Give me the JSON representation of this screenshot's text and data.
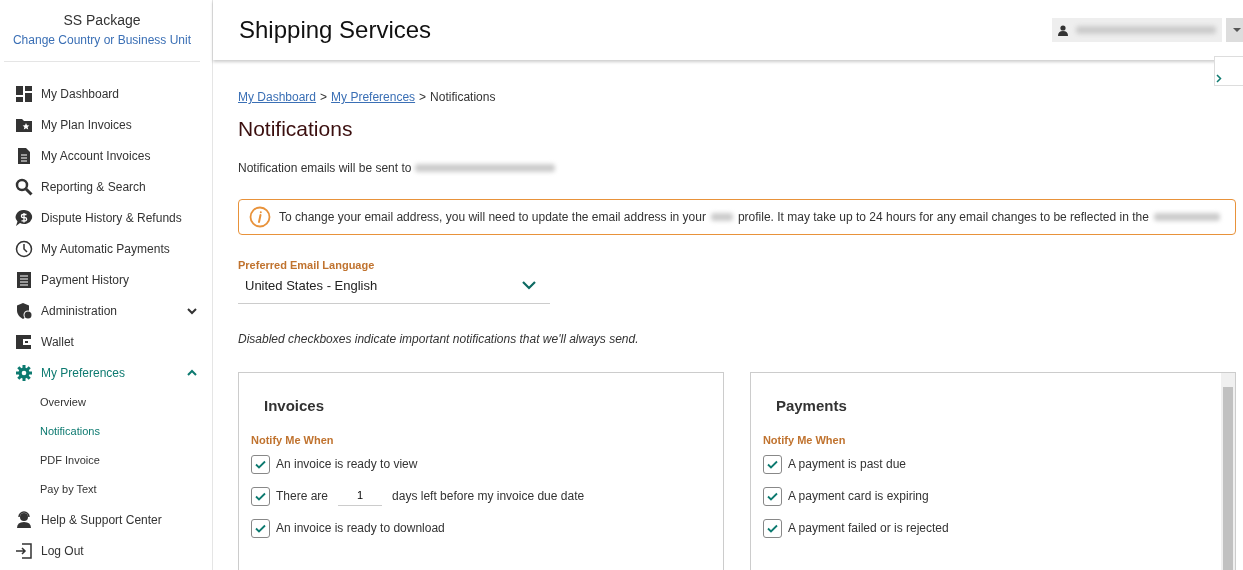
{
  "sidebar": {
    "title": "SS Package",
    "link": "Change Country or Business Unit",
    "items": [
      {
        "label": "My Dashboard",
        "selected": false
      },
      {
        "label": "My Plan Invoices",
        "selected": false
      },
      {
        "label": "My Account Invoices",
        "selected": false
      },
      {
        "label": "Reporting & Search",
        "selected": false
      },
      {
        "label": "Dispute History & Refunds",
        "selected": false
      },
      {
        "label": "My Automatic Payments",
        "selected": false
      },
      {
        "label": "Payment History",
        "selected": false
      },
      {
        "label": "Administration",
        "selected": false,
        "expanded": false
      },
      {
        "label": "Wallet",
        "selected": false
      },
      {
        "label": "My Preferences",
        "selected": true,
        "expanded": true,
        "children": [
          {
            "label": "Overview",
            "selected": false
          },
          {
            "label": "Notifications",
            "selected": true
          },
          {
            "label": "PDF Invoice",
            "selected": false
          },
          {
            "label": "Pay by Text",
            "selected": false
          }
        ]
      },
      {
        "label": "Help & Support Center",
        "selected": false
      },
      {
        "label": "Log Out",
        "selected": false
      }
    ]
  },
  "header": {
    "title": "Shipping Services"
  },
  "breadcrumb": [
    {
      "label": "My Dashboard",
      "kind": "link"
    },
    {
      "label": ">",
      "kind": "separator"
    },
    {
      "label": "My Preferences",
      "kind": "link"
    },
    {
      "label": ">",
      "kind": "separator"
    },
    {
      "label": "Notifications",
      "kind": "current"
    }
  ],
  "page_title": "Notifications",
  "email_note": "Notification emails will be sent to",
  "alert": {
    "parts": [
      "To change your email address, you will need to update the email address in your",
      "profile. It may take up to 24 hours for any email changes to be reflected in the"
    ]
  },
  "language": {
    "label": "Preferred Email Language",
    "value": "United States - English"
  },
  "disabled_note": "Disabled checkboxes indicate important notifications that we'll always send.",
  "panels": [
    {
      "title": "Invoices",
      "subtitle": "Notify Me When",
      "options": [
        {
          "kind": "plain",
          "label": "An invoice is ready to view",
          "checked": true
        },
        {
          "kind": "days",
          "before": "There are",
          "value": "1",
          "after": "days left before my invoice due date",
          "checked": true
        },
        {
          "kind": "plain",
          "label": "An invoice is ready to download",
          "checked": true
        }
      ]
    },
    {
      "title": "Payments",
      "subtitle": "Notify Me When",
      "options": [
        {
          "kind": "plain",
          "label": "A payment is past due",
          "checked": true
        },
        {
          "kind": "plain",
          "label": "A payment card is expiring",
          "checked": true
        },
        {
          "kind": "plain",
          "label": "A payment failed or is rejected",
          "checked": true
        }
      ]
    }
  ]
}
